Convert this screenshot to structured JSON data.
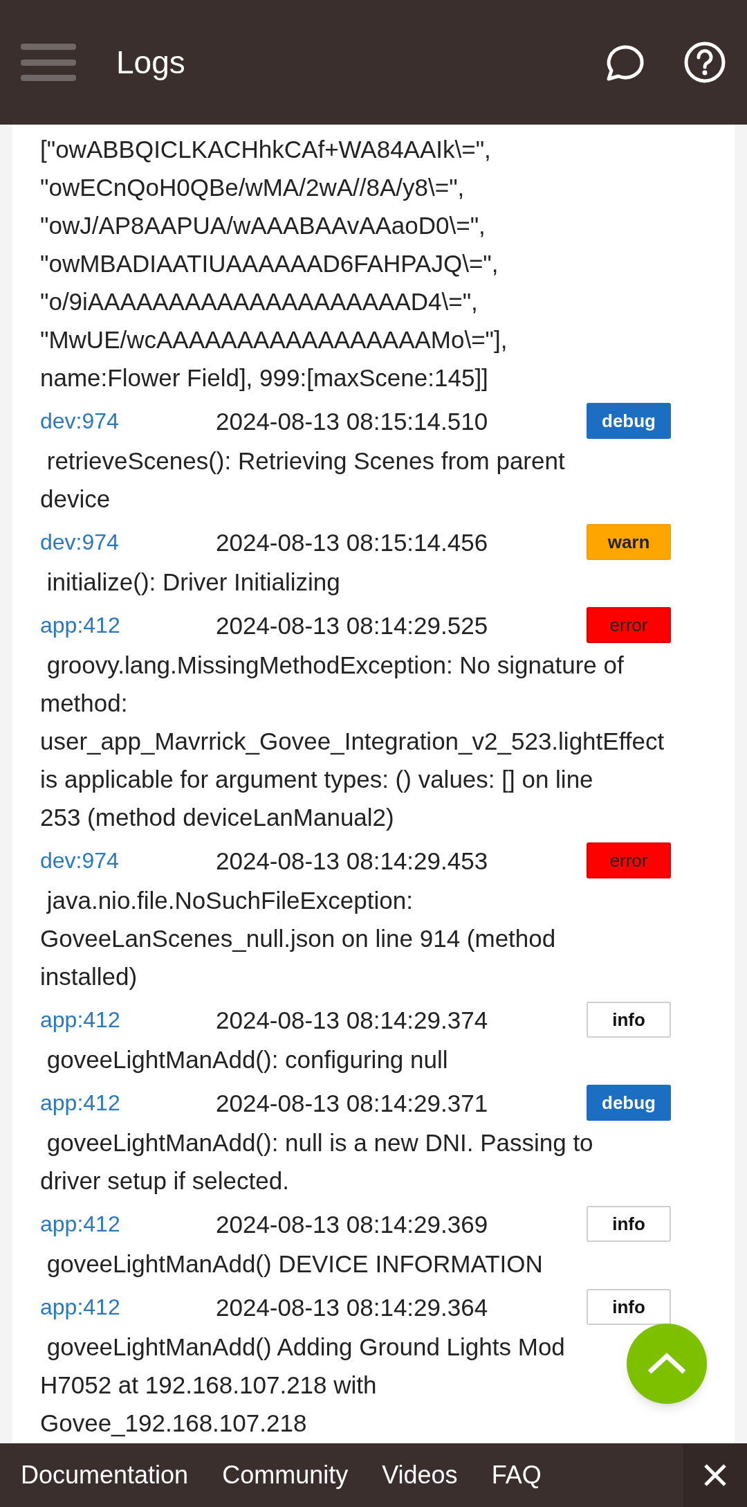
{
  "app_bar": {
    "title": "Logs"
  },
  "continued_message": [
    "[\"owABBQICLKACHhkCAf+WA84AAIk\\=\",",
    "\"owECnQoH0QBe/wMA/2wA//8A/y8\\=\",",
    "\"owJ/AP8AAPUA/wAAABAAvAAaoD0\\=\",",
    "\"owMBADIAATIUAAAAAAD6FAHPAJQ\\=\",",
    "\"o/9iAAAAAAAAAAAAAAAAAAAAD4\\=\",",
    "\"MwUE/wcAAAAAAAAAAAAAAAAAMo\\=\"],",
    "name:Flower Field], 999:[maxScene:145]]"
  ],
  "entries": [
    {
      "source": "dev:974",
      "timestamp": "2024-08-13 08:15:14.510",
      "severity": "debug",
      "lines": [
        " retrieveScenes(): Retrieving Scenes from parent",
        "device"
      ]
    },
    {
      "source": "dev:974",
      "timestamp": "2024-08-13 08:15:14.456",
      "severity": "warn",
      "lines": [
        " initialize(): Driver Initializing"
      ]
    },
    {
      "source": "app:412",
      "timestamp": "2024-08-13 08:14:29.525",
      "severity": "error",
      "lines": [
        " groovy.lang.MissingMethodException: No signature of",
        "method:",
        "user_app_Mavrrick_Govee_Integration_v2_523.lightEffect",
        "is applicable for argument types: () values: [] on line",
        "253 (method deviceLanManual2)"
      ]
    },
    {
      "source": "dev:974",
      "timestamp": "2024-08-13 08:14:29.453",
      "severity": "error",
      "lines": [
        " java.nio.file.NoSuchFileException:",
        "GoveeLanScenes_null.json on line 914 (method",
        "installed)"
      ]
    },
    {
      "source": "app:412",
      "timestamp": "2024-08-13 08:14:29.374",
      "severity": "info",
      "lines": [
        " goveeLightManAdd(): configuring null"
      ]
    },
    {
      "source": "app:412",
      "timestamp": "2024-08-13 08:14:29.371",
      "severity": "debug",
      "lines": [
        " goveeLightManAdd(): null is a new DNI. Passing to",
        "driver setup if selected."
      ]
    },
    {
      "source": "app:412",
      "timestamp": "2024-08-13 08:14:29.369",
      "severity": "info",
      "lines": [
        " goveeLightManAdd() DEVICE INFORMATION"
      ]
    },
    {
      "source": "app:412",
      "timestamp": "2024-08-13 08:14:29.364",
      "severity": "info",
      "lines": [
        " goveeLightManAdd() Adding Ground Lights Mod",
        "H7052 at 192.168.107.218 with",
        "Govee_192.168.107.218"
      ]
    }
  ],
  "footer_links": [
    "Documentation",
    "Community",
    "Videos",
    "FAQ"
  ]
}
